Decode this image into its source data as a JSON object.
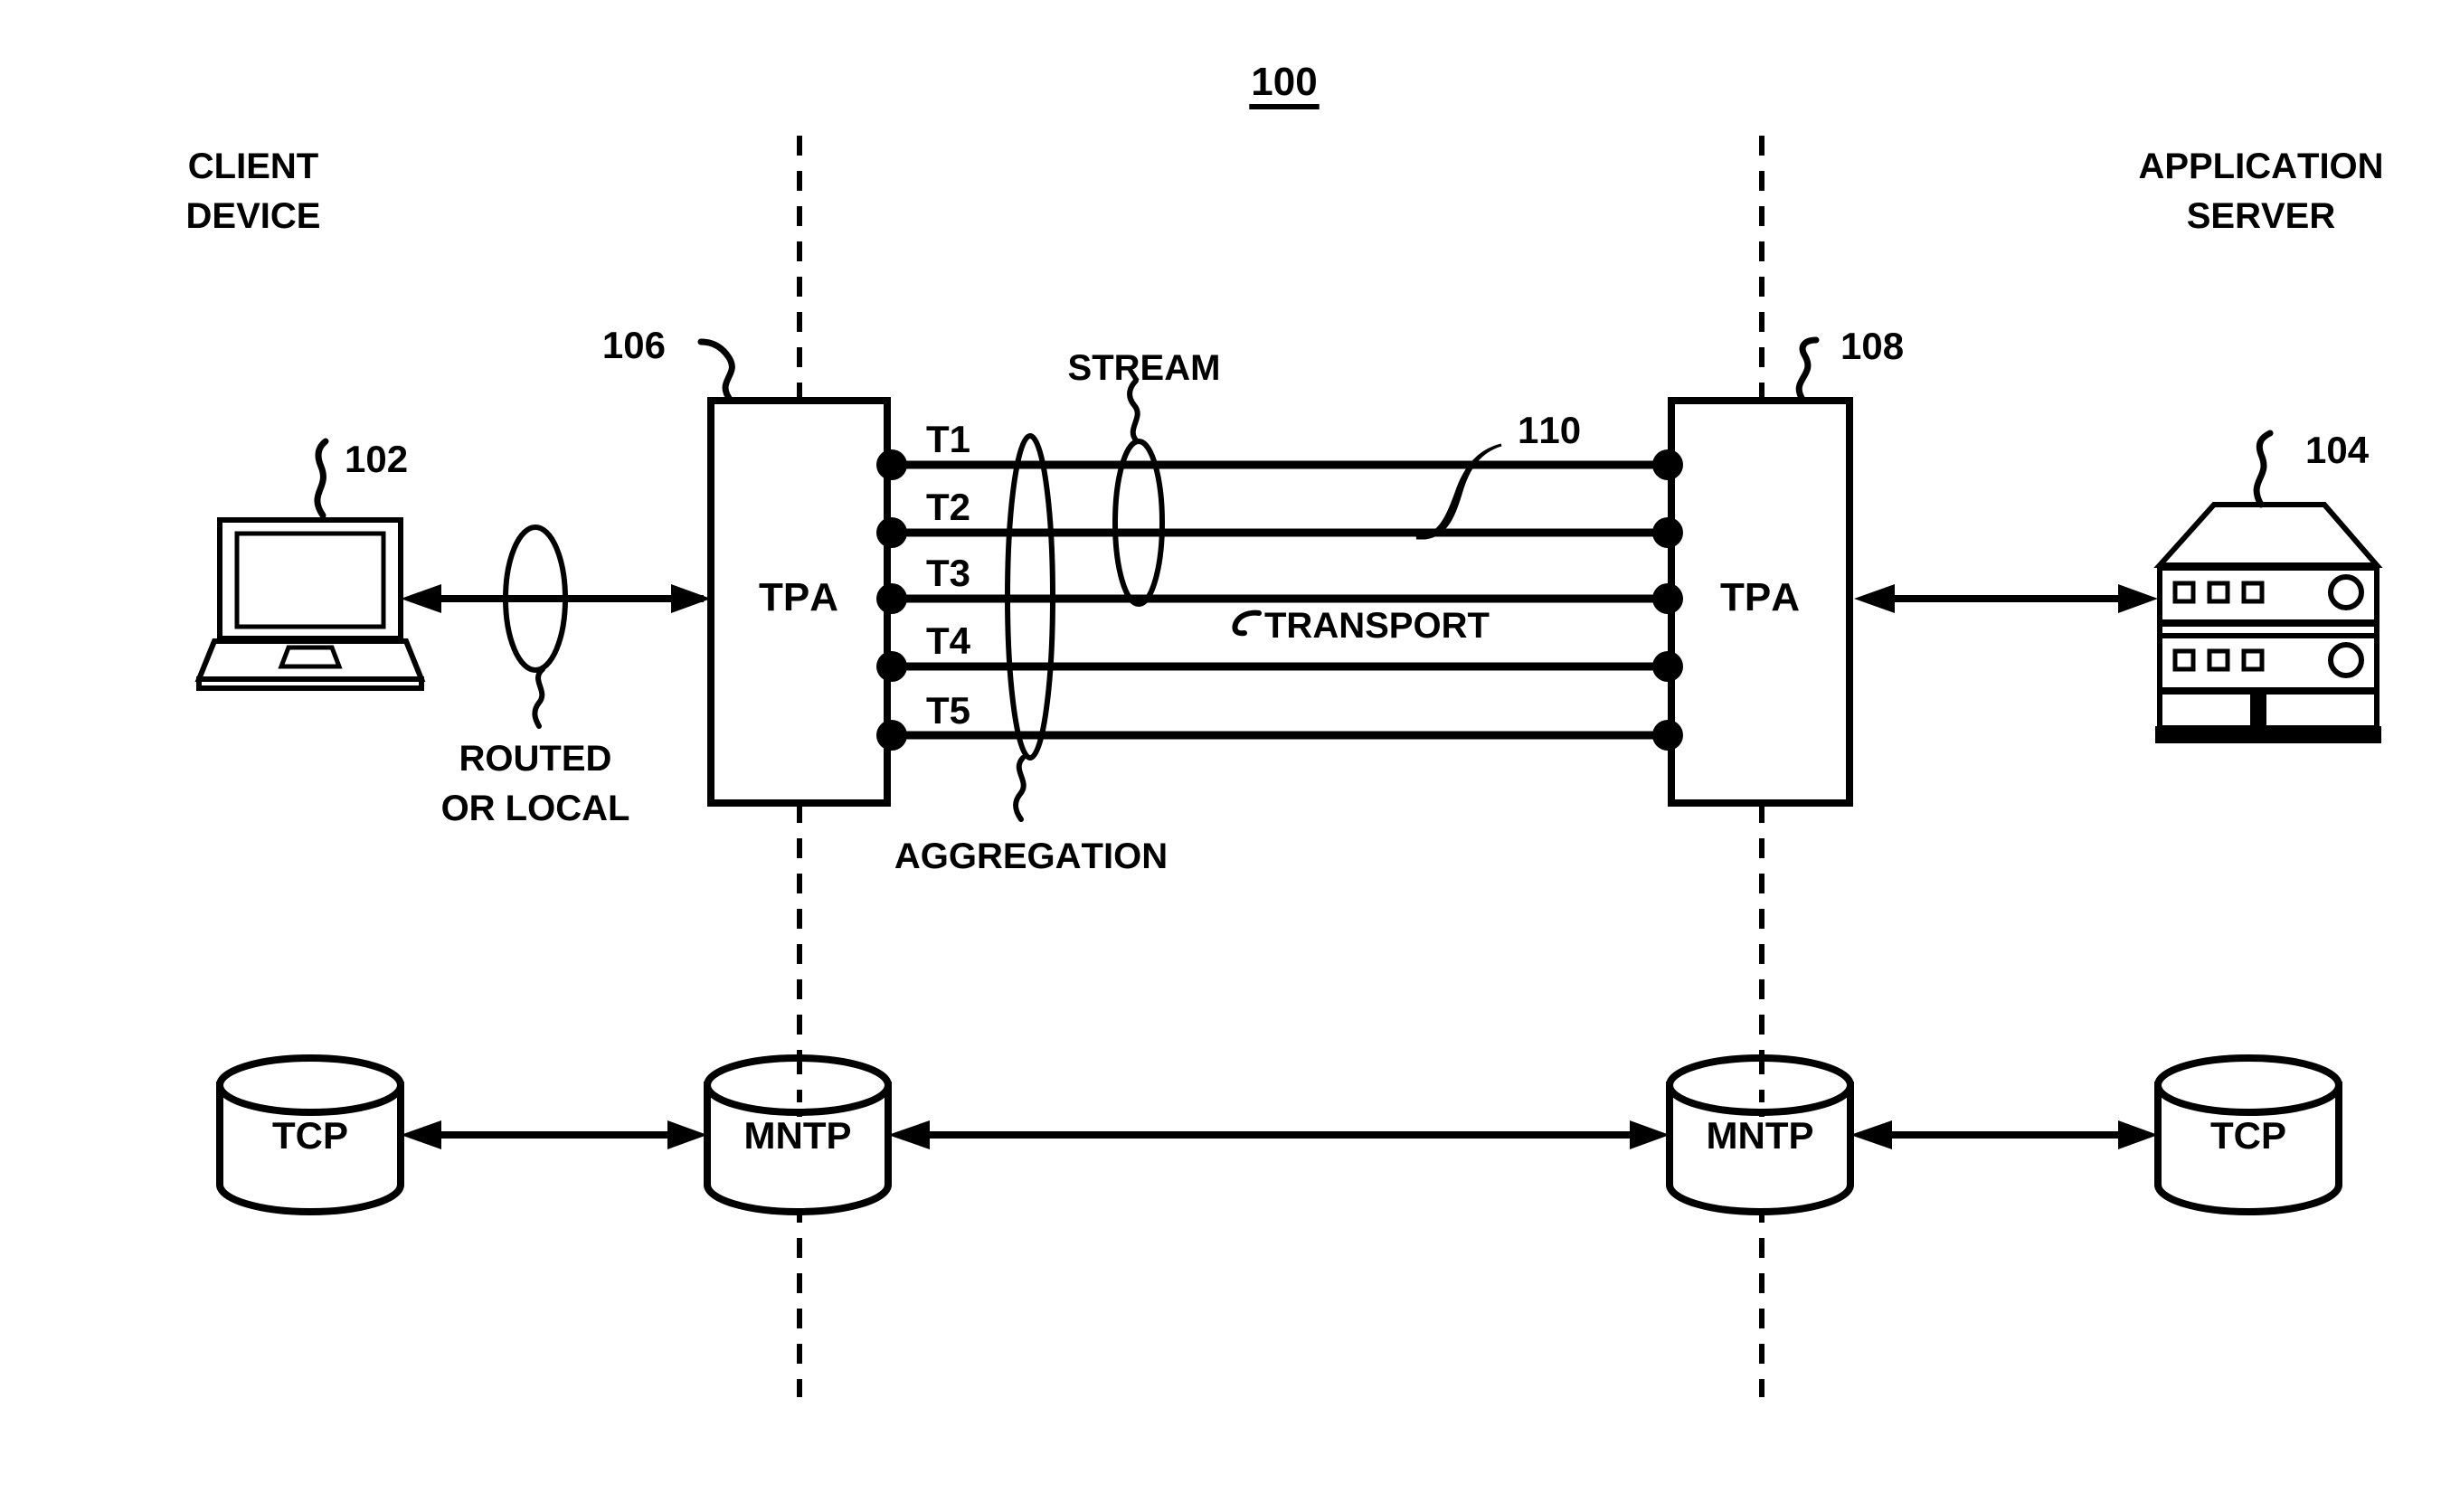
{
  "figure": {
    "number": "100",
    "number_underlined": true
  },
  "labels": {
    "client_device_line1": "CLIENT",
    "client_device_line2": "DEVICE",
    "application_server_line1": "APPLICATION",
    "application_server_line2": "SERVER",
    "routed_or_local_line1": "ROUTED",
    "routed_or_local_line2": "OR  LOCAL",
    "stream": "STREAM",
    "transport": "TRANSPORT",
    "aggregation": "AGGREGATION"
  },
  "references": {
    "client_device": "102",
    "application_server": "104",
    "tpa_left": "106",
    "tpa_right": "108",
    "stream_link": "110"
  },
  "nodes": {
    "tpa_left": "TPA",
    "tpa_right": "TPA",
    "mntp_left": "MNTP",
    "mntp_right": "MNTP",
    "tcp_left": "TCP",
    "tcp_right": "TCP"
  },
  "transports": [
    {
      "id": "T1",
      "label": "T1"
    },
    {
      "id": "T2",
      "label": "T2"
    },
    {
      "id": "T3",
      "label": "T3"
    },
    {
      "id": "T4",
      "label": "T4"
    },
    {
      "id": "T5",
      "label": "T5"
    }
  ],
  "colors": {
    "stroke": "#000000",
    "background": "#ffffff",
    "fill": "#ffffff"
  }
}
